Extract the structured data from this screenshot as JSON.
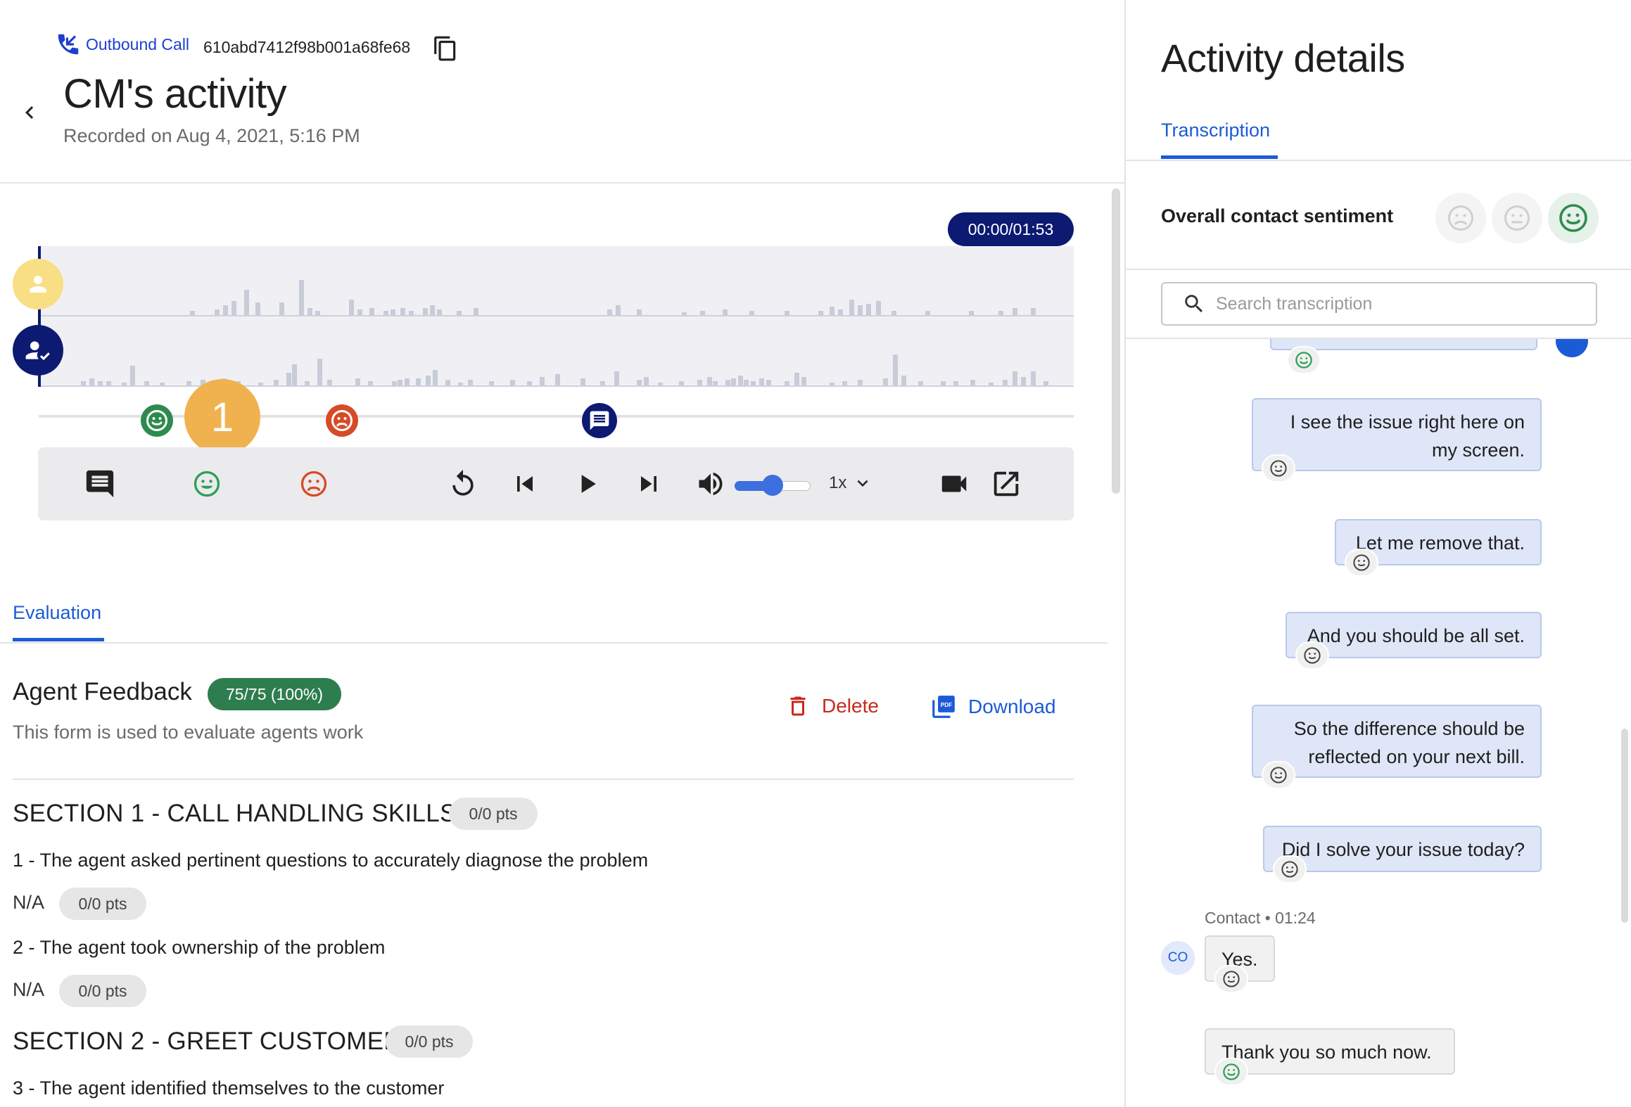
{
  "header": {
    "call_type": "Outbound Call",
    "call_id": "610abd7412f98b001a68fe68",
    "title": "CM's activity",
    "recorded": "Recorded on Aug 4, 2021, 5:16 PM"
  },
  "player": {
    "time": "00:00/01:53",
    "step_badge": "1",
    "speed": "1x",
    "volume_fraction": 0.5
  },
  "evaluation": {
    "tab_label": "Evaluation",
    "form_title": "Agent Feedback",
    "score": "75/75 (100%)",
    "description": "This form is used to evaluate agents work",
    "delete_label": "Delete",
    "download_label": "Download",
    "sections": [
      {
        "title": "SECTION 1 - CALL HANDLING SKILLS",
        "pts": "0/0 pts"
      },
      {
        "title": "SECTION 2 - GREET CUSTOMER",
        "pts": "0/0 pts"
      }
    ],
    "questions": [
      {
        "text": "1 - The agent asked pertinent questions to accurately diagnose the problem",
        "answer": "N/A",
        "pts": "0/0 pts"
      },
      {
        "text": "2 - The agent took ownership of the problem",
        "answer": "N/A",
        "pts": "0/0 pts"
      },
      {
        "text": "3 - The agent identified themselves to the customer"
      }
    ]
  },
  "panel": {
    "title": "Activity details",
    "tab": "Transcription",
    "sentiment_label": "Overall contact sentiment",
    "sentiment_selected": "positive",
    "search_placeholder": "Search transcription"
  },
  "transcript": {
    "agent_messages": [
      {
        "line1": "I see the issue right here on",
        "line2": "my screen."
      },
      {
        "line1": "Let me remove that."
      },
      {
        "line1": "And you should be all set."
      },
      {
        "line1": "So the difference should be",
        "line2": "reflected on your next bill."
      },
      {
        "line1": "Did I solve your issue today?"
      }
    ],
    "contact_meta": "Contact • 01:24",
    "contact_initials": "CO",
    "contact_messages": [
      "Yes.",
      "Thank you so much now."
    ]
  },
  "colors": {
    "accent": "#1c5bd6",
    "navy": "#0d1a72",
    "positive": "#2e8b4e",
    "negative": "#d64b27",
    "badge": "#f0b24e"
  }
}
